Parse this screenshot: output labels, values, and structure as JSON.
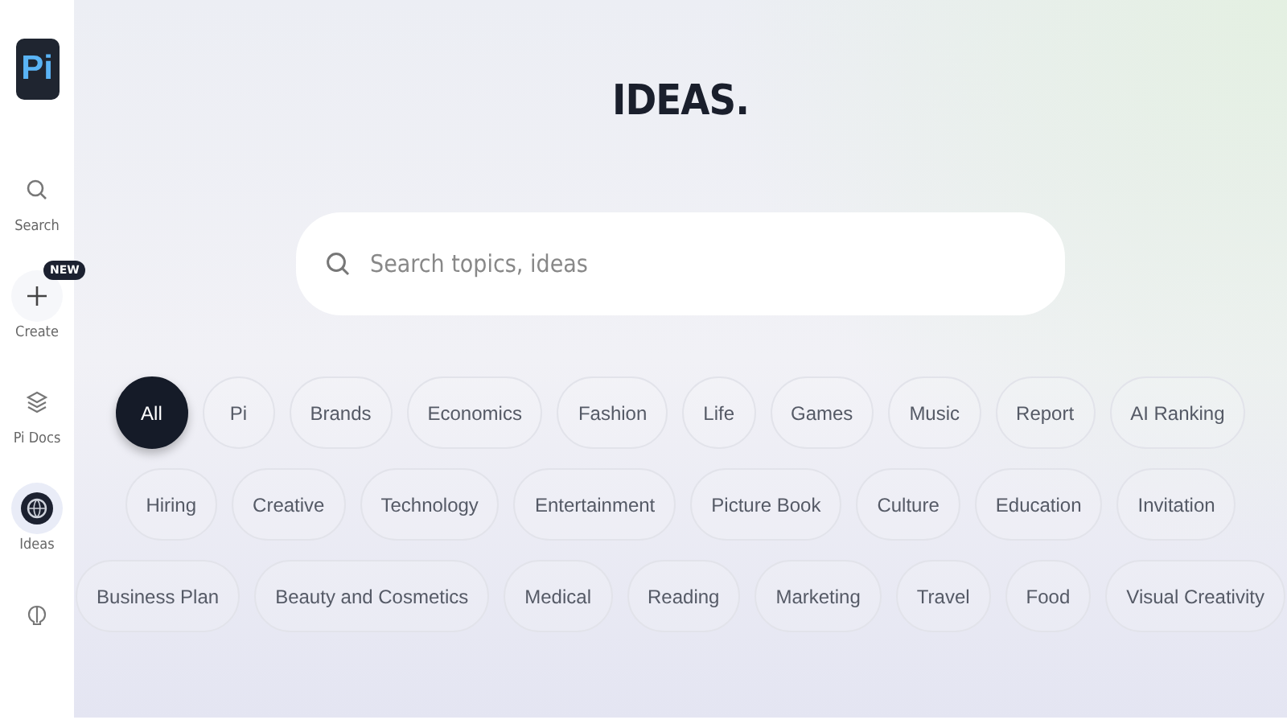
{
  "sidebar": {
    "logo": "Pi",
    "items": [
      {
        "kind": "search",
        "label": "Search",
        "selected": false
      },
      {
        "kind": "create",
        "label": "Create",
        "badge": "NEW",
        "selected": false
      },
      {
        "kind": "docs",
        "label": "Pi Docs",
        "selected": false
      },
      {
        "kind": "ideas",
        "label": "Ideas",
        "selected": true
      },
      {
        "kind": "more",
        "selected": false
      }
    ]
  },
  "title": "IDEAS.",
  "search": {
    "placeholder": "Search topics, ideas"
  },
  "tag_rows": [
    [
      {
        "label": "All",
        "selected": true
      },
      {
        "label": "Pi",
        "selected": false
      },
      {
        "label": "Brands",
        "selected": false
      },
      {
        "label": "Economics",
        "selected": false
      },
      {
        "label": "Fashion",
        "selected": false
      },
      {
        "label": "Life",
        "selected": false
      },
      {
        "label": "Games",
        "selected": false
      },
      {
        "label": "Music",
        "selected": false
      },
      {
        "label": "Report",
        "selected": false
      },
      {
        "label": "AI Ranking",
        "selected": false
      }
    ],
    [
      {
        "label": "Hiring",
        "selected": false
      },
      {
        "label": "Creative",
        "selected": false
      },
      {
        "label": "Technology",
        "selected": false
      },
      {
        "label": "Entertainment",
        "selected": false
      },
      {
        "label": "Picture Book",
        "selected": false
      },
      {
        "label": "Culture",
        "selected": false
      },
      {
        "label": "Education",
        "selected": false
      },
      {
        "label": "Invitation",
        "selected": false
      }
    ],
    [
      {
        "label": "Business Plan",
        "selected": false
      },
      {
        "label": "Beauty and Cosmetics",
        "selected": false
      },
      {
        "label": "Medical",
        "selected": false
      },
      {
        "label": "Reading",
        "selected": false
      },
      {
        "label": "Marketing",
        "selected": false
      },
      {
        "label": "Travel",
        "selected": false
      },
      {
        "label": "Food",
        "selected": false
      },
      {
        "label": "Visual Creativity",
        "selected": false
      }
    ]
  ]
}
